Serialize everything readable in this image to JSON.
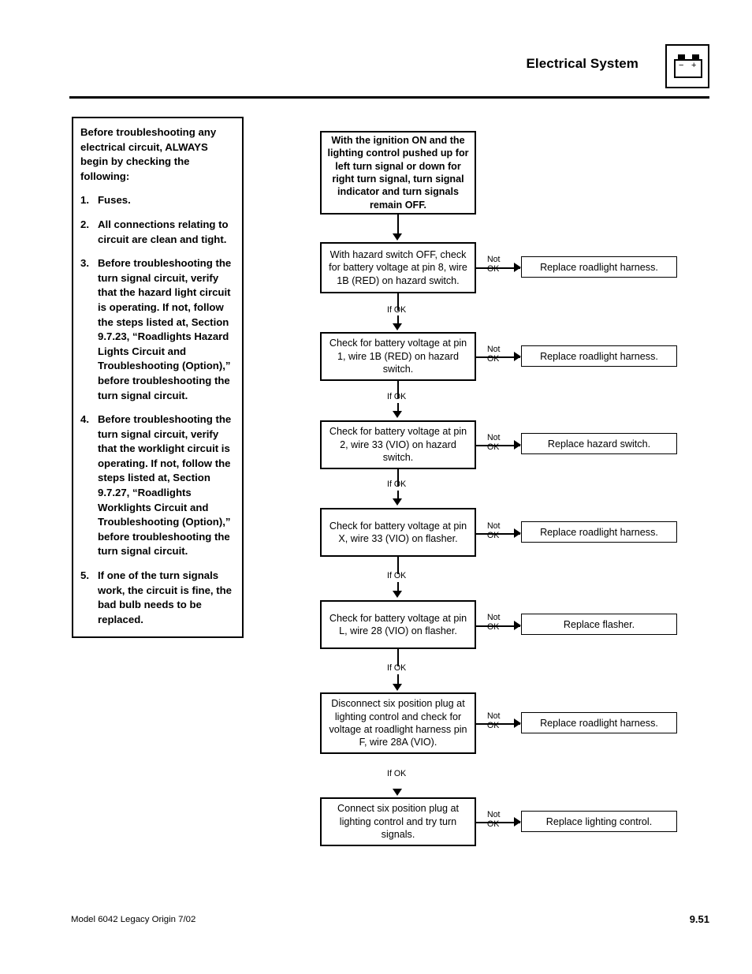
{
  "header": {
    "title": "Electrical System",
    "badge_icon": "battery-icon",
    "battery_minus": "−",
    "battery_plus": "+"
  },
  "notes": {
    "intro": "Before troubleshooting any electrical circuit, ALWAYS begin by checking the following:",
    "items": [
      {
        "num": "1.",
        "text": "Fuses."
      },
      {
        "num": "2.",
        "text": "All connections relating to circuit are clean and tight."
      },
      {
        "num": "3.",
        "text": "Before troubleshooting the turn signal circuit, verify that the hazard light circuit is operating. If not, follow the steps listed at, Section 9.7.23, “Roadlights Hazard Lights Circuit and Troubleshooting (Option),” before troubleshooting the turn signal circuit."
      },
      {
        "num": "4.",
        "text": "Before troubleshooting the turn signal circuit, verify that the worklight circuit is operating. If not, follow the steps listed at, Section 9.7.27, “Roadlights Worklights Circuit and Troubleshooting (Option),” before troubleshooting the turn signal circuit."
      },
      {
        "num": "5.",
        "text": "If one of the turn signals work, the circuit is fine, the bad bulb needs to be replaced."
      }
    ]
  },
  "flow": {
    "start_box": "With the ignition ON and the lighting control pushed up for left turn signal or down for right turn signal, turn signal indicator and turn signals remain OFF.",
    "if_ok_label": "If OK",
    "not_ok_label_line1": "Not",
    "not_ok_label_line2": "OK",
    "steps": [
      {
        "check": "With hazard switch OFF, check for battery voltage at pin 8, wire 1B (RED) on hazard switch.",
        "action": "Replace roadlight harness."
      },
      {
        "check": "Check for battery voltage at pin 1, wire 1B (RED) on hazard switch.",
        "action": "Replace roadlight harness."
      },
      {
        "check": "Check for battery voltage at pin 2, wire 33 (VIO) on hazard switch.",
        "action": "Replace hazard switch."
      },
      {
        "check": "Check for battery voltage at pin X, wire 33 (VIO) on flasher.",
        "action": "Replace roadlight harness."
      },
      {
        "check": "Check for battery voltage at pin L, wire 28 (VIO) on flasher.",
        "action": "Replace flasher."
      },
      {
        "check": "Disconnect six position plug at lighting control and check for voltage at roadlight harness pin F, wire 28A (VIO).",
        "action": "Replace roadlight harness."
      },
      {
        "check": "Connect six position plug at lighting control and try turn signals.",
        "action": "Replace lighting control."
      }
    ]
  },
  "footer": {
    "left": "Model  6042  Legacy    Origin  7/02",
    "page": "9.51"
  }
}
